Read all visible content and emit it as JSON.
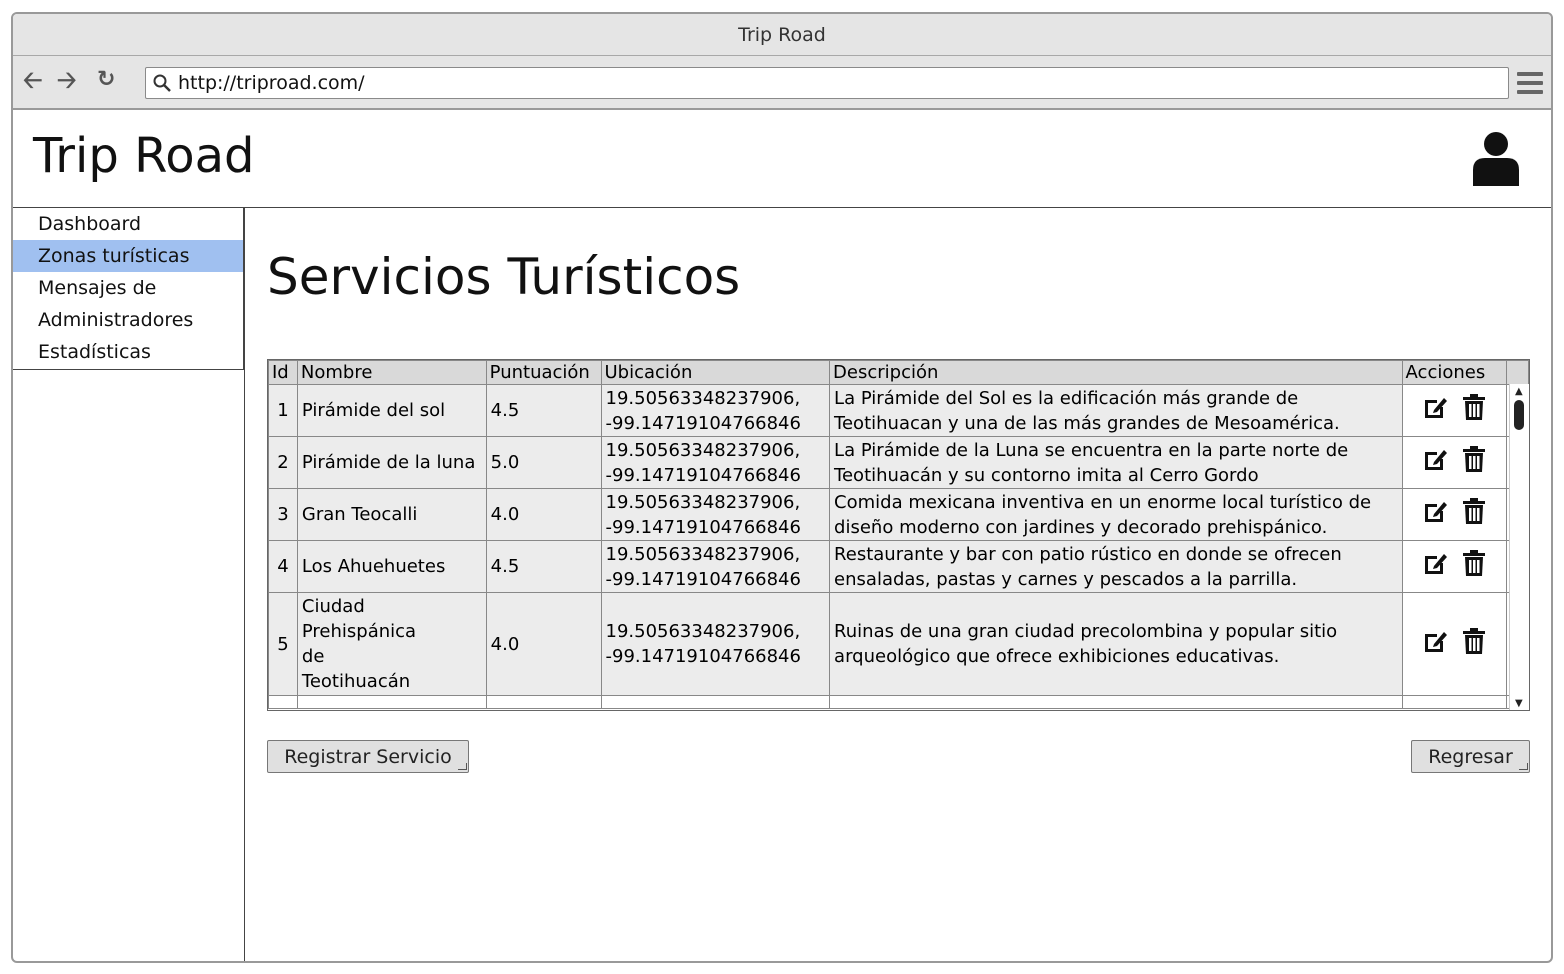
{
  "window": {
    "title": "Trip Road"
  },
  "browser": {
    "url": "http://triproad.com/"
  },
  "header": {
    "brand": "Trip Road"
  },
  "sidebar": {
    "items": [
      {
        "label": "Dashboard",
        "active": false
      },
      {
        "label": "Zonas turísticas",
        "active": true
      },
      {
        "label": "Mensajes de",
        "active": false
      },
      {
        "label": "Administradores",
        "active": false
      },
      {
        "label": "Estadísticas",
        "active": false
      }
    ]
  },
  "main": {
    "title": "Servicios Turísticos",
    "table": {
      "columns": [
        "Id",
        "Nombre",
        "Puntuación",
        "Ubicación",
        "Descripción",
        "Acciones"
      ],
      "rows": [
        {
          "id": "1",
          "nombre": [
            "Pirámide del sol"
          ],
          "puntuacion": "4.5",
          "ubicacion": [
            "19.50563348237906,",
            "-99.14719104766846"
          ],
          "descripcion": [
            "La Pirámide del Sol es la edificación más grande de",
            "Teotihuacan y una de las más grandes de Mesoamérica."
          ]
        },
        {
          "id": "2",
          "nombre": [
            "Pirámide de la luna"
          ],
          "puntuacion": "5.0",
          "ubicacion": [
            " 19.50563348237906,",
            "-99.14719104766846"
          ],
          "descripcion": [
            "La Pirámide de la Luna se encuentra en la parte norte de",
            "Teotihuacán y su contorno imita al Cerro Gordo"
          ]
        },
        {
          "id": "3",
          "nombre": [
            "Gran Teocalli"
          ],
          "puntuacion": "4.0",
          "ubicacion": [
            " 19.50563348237906,",
            "-99.14719104766846"
          ],
          "descripcion": [
            "Comida mexicana inventiva en un enorme local turístico de",
            "diseño moderno con jardines y decorado prehispánico."
          ]
        },
        {
          "id": "4",
          "nombre": [
            "Los Ahuehuetes"
          ],
          "puntuacion": "4.5",
          "ubicacion": [
            "19.50563348237906,",
            "-99.14719104766846"
          ],
          "descripcion": [
            "Restaurante y bar con patio rústico en donde se ofrecen",
            "ensaladas, pastas y carnes y pescados a la parrilla."
          ]
        },
        {
          "id": "5",
          "nombre": [
            "Ciudad",
            "Prehispánica",
            "de",
            "Teotihuacán"
          ],
          "puntuacion": "4.0",
          "ubicacion": [
            " 19.50563348237906,",
            "-99.14719104766846"
          ],
          "descripcion": [
            "Ruinas de una gran ciudad precolombina y popular sitio",
            "arqueológico que ofrece exhibiciones educativas."
          ]
        }
      ],
      "row_actions": {
        "edit_icon": "edit-icon",
        "delete_icon": "trash-icon"
      }
    },
    "buttons": {
      "register": "Registrar Servicio",
      "back": "Regresar"
    }
  },
  "colors": {
    "active_nav": "#a0c0f0",
    "chrome": "#e5e5e5",
    "header_cell": "#d9d9d9",
    "row_bg": "#ececec"
  }
}
